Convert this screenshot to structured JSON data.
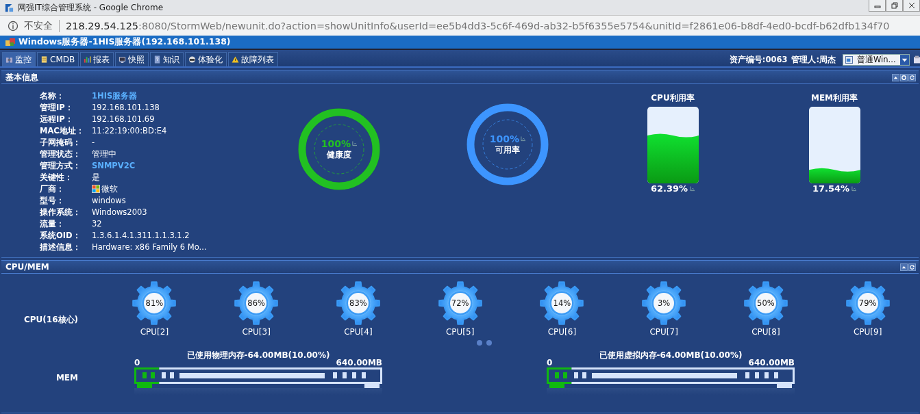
{
  "browser": {
    "title": "网强IT综合管理系统 - Google Chrome",
    "security": "不安全",
    "url_host": "218.29.54.125",
    "url_path": ":8080/StormWeb/newunit.do?action=showUnitInfo&userId=ee5b4dd3-5c6f-469d-ab32-b5f6355e5754&unitId=f2861e06-b8df-4ed0-bcdf-b62dfb134f70"
  },
  "header": {
    "title": "Windows服务器-1HIS服务器(192.168.101.138)"
  },
  "tabs": [
    {
      "label": "监控",
      "selected": true
    },
    {
      "label": "CMDB",
      "selected": false
    },
    {
      "label": "报表",
      "selected": false
    },
    {
      "label": "快照",
      "selected": false
    },
    {
      "label": "知识",
      "selected": false
    },
    {
      "label": "体验化",
      "selected": false
    },
    {
      "label": "故障列表",
      "selected": false
    }
  ],
  "asset": "资产编号:0063",
  "manager": "管理人:周杰",
  "template": {
    "value": "普通Win..."
  },
  "basic_info": {
    "title": "基本信息",
    "fields": [
      {
        "label": "名称：",
        "value": "1HIS服务器",
        "kind": "link"
      },
      {
        "label": "管理IP：",
        "value": "192.168.101.138",
        "kind": "text"
      },
      {
        "label": "远程IP：",
        "value": "192.168.101.69",
        "kind": "text"
      },
      {
        "label": "MAC地址：",
        "value": "11:22:19:00:BD:E4",
        "kind": "text"
      },
      {
        "label": "子网掩码：",
        "value": "-",
        "kind": "text"
      },
      {
        "label": "管理状态：",
        "value": "管理中",
        "kind": "text"
      },
      {
        "label": "管理方式：",
        "value": "SNMPV2C",
        "kind": "link"
      },
      {
        "label": "关键性：",
        "value": "是",
        "kind": "text"
      },
      {
        "label": "厂商：",
        "value": "微软",
        "kind": "vendor"
      },
      {
        "label": "型号：",
        "value": "windows",
        "kind": "text"
      },
      {
        "label": "操作系统：",
        "value": "Windows2003",
        "kind": "text"
      },
      {
        "label": "流量：",
        "value": "32",
        "kind": "text"
      },
      {
        "label": "系统OID：",
        "value": "1.3.6.1.4.1.311.1.1.3.1.2",
        "kind": "text"
      },
      {
        "label": "描述信息：",
        "value": "Hardware: x86 Family 6 Mo...",
        "kind": "text"
      }
    ],
    "rings": [
      {
        "value": "100%",
        "label": "健康度",
        "level": 1,
        "color": "#22c022"
      },
      {
        "value": "100%",
        "label": "可用率",
        "level": 1,
        "color": "#3d95ff"
      }
    ],
    "tanks": [
      {
        "title": "CPU利用率",
        "value": "62.39%",
        "level": 0.6239
      },
      {
        "title": "MEM利用率",
        "value": "17.54%",
        "level": 0.1754
      }
    ]
  },
  "cpu_mem": {
    "title": "CPU/MEM",
    "cpu_label": "CPU(16核心)",
    "cores": [
      {
        "value": "81%",
        "label": "CPU[2]"
      },
      {
        "value": "86%",
        "label": "CPU[3]"
      },
      {
        "value": "83%",
        "label": "CPU[4]"
      },
      {
        "value": "72%",
        "label": "CPU[5]"
      },
      {
        "value": "14%",
        "label": "CPU[6]"
      },
      {
        "value": "3%",
        "label": "CPU[7]"
      },
      {
        "value": "50%",
        "label": "CPU[8]"
      },
      {
        "value": "79%",
        "label": "CPU[9]"
      }
    ],
    "mem_label": "MEM",
    "memory": [
      {
        "title": "已使用物理内存-64.00MB(10.00%)",
        "min": "0",
        "max": "640.00MB",
        "level": 0.1
      },
      {
        "title": "已使用虚拟内存-64.00MB(10.00%)",
        "min": "0",
        "max": "640.00MB",
        "level": 0.1
      }
    ]
  }
}
